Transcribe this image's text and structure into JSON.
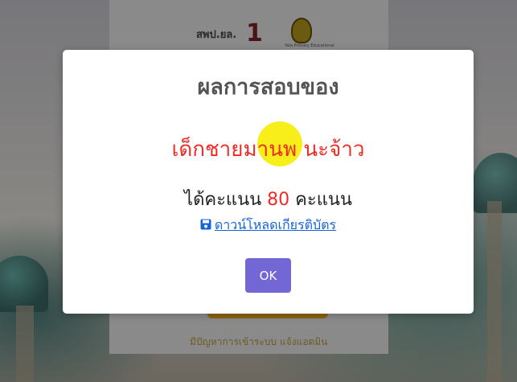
{
  "background": {
    "logo_text": "สพป.ยล.",
    "logo_number": "1",
    "logo_caption": "Yala Primary Educational",
    "help_text": "มีปัญหาการเข้าระบบ แจ้งแอดมิน"
  },
  "modal": {
    "title": "ผลการสอบของ",
    "student_name": "เด็กชายมานพ นะจ้าว",
    "score_prefix": "ได้คะแนน",
    "score_value": "80",
    "score_suffix": "คะแนน",
    "download_label": "ดาวน์โหลดเกียรติบัตร",
    "download_icon": "save-icon",
    "ok_label": "OK"
  },
  "colors": {
    "name_red": "#ef2d26",
    "link_blue": "#1565d8",
    "ok_purple": "#7367d6",
    "highlight_yellow": "#f8ee1a"
  }
}
